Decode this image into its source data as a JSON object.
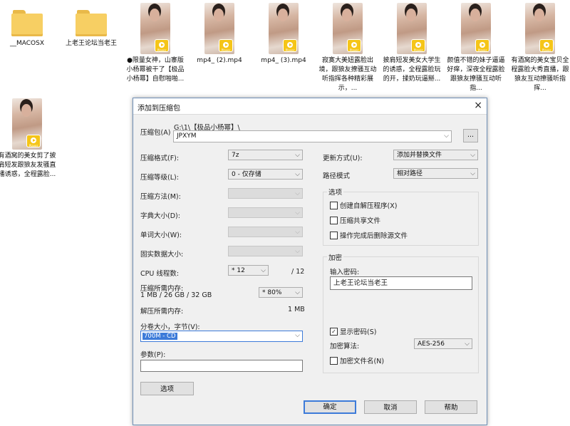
{
  "desktop": {
    "folders": [
      {
        "label": "__MACOSX"
      },
      {
        "label": "上老王论坛当老王"
      }
    ],
    "videos": [
      {
        "label": "●限量女神，山寨版小杨幂被干了【极品小杨幂】自慰啪啪..."
      },
      {
        "label": "mp4_ (2).mp4"
      },
      {
        "label": "mp4_ (3).mp4"
      },
      {
        "label": "寂寞大美妞露脸出境，跟狼友撩骚互动听指挥各种精彩展示，..."
      },
      {
        "label": "披肩短发美女大学生的诱惑，全程露脸玩的开，揉奶玩逼掰..."
      },
      {
        "label": "颜值不错的妹子逼逼好痒，深夜全程露脸跟狼友撩骚互动听指..."
      },
      {
        "label": "有酒窝的美女宝贝全程露脸大秀直播，跟狼友互动撩骚听指挥..."
      },
      {
        "label": "有酒窝的美女剪了披肩短发跟狼友发骚直播诱惑，全程露脸..."
      }
    ],
    "badge_text": "Player"
  },
  "dialog": {
    "title": "添加到压缩包",
    "close_icon": "×",
    "archive_label": "压缩包(A)",
    "archive_path": "G:\\1\\【极品小杨幂】\\",
    "archive_name": "JPXYM",
    "browse_label": "...",
    "format_label": "压缩格式(F):",
    "format_value": "7z",
    "level_label": "压缩等级(L):",
    "level_value": "0 - 仅存储",
    "method_label": "压缩方法(M):",
    "dict_label": "字典大小(D):",
    "word_label": "单词大小(W):",
    "solid_label": "固实数据大小:",
    "cpu_label": "CPU 线程数:",
    "cpu_value": "* 12",
    "cpu_total": "/ 12",
    "mem_label": "压缩所需内存:",
    "mem_detail": "1 MB / 26 GB / 32 GB",
    "mem_value": "* 80%",
    "decomp_label": "解压所需内存:",
    "decomp_value": "1 MB",
    "volume_label": "分卷大小，字节(V):",
    "volume_value": "700M - CD",
    "params_label": "参数(P):",
    "params_value": "",
    "update_label": "更新方式(U):",
    "update_value": "添加并替换文件",
    "path_label": "路径模式",
    "path_value": "相对路径",
    "options_title": "选项",
    "opt_sfx": "创建自解压程序(X)",
    "opt_shared": "压缩共享文件",
    "opt_delete": "操作完成后删除源文件",
    "enc_title": "加密",
    "pwd_label": "输入密码:",
    "pwd_value": "上老王论坛当老王",
    "show_pwd": "显示密码(S)",
    "enc_method_label": "加密算法:",
    "enc_method_value": "AES-256",
    "enc_names": "加密文件名(N)",
    "options_btn": "选项",
    "ok_btn": "确定",
    "cancel_btn": "取消",
    "help_btn": "帮助"
  }
}
